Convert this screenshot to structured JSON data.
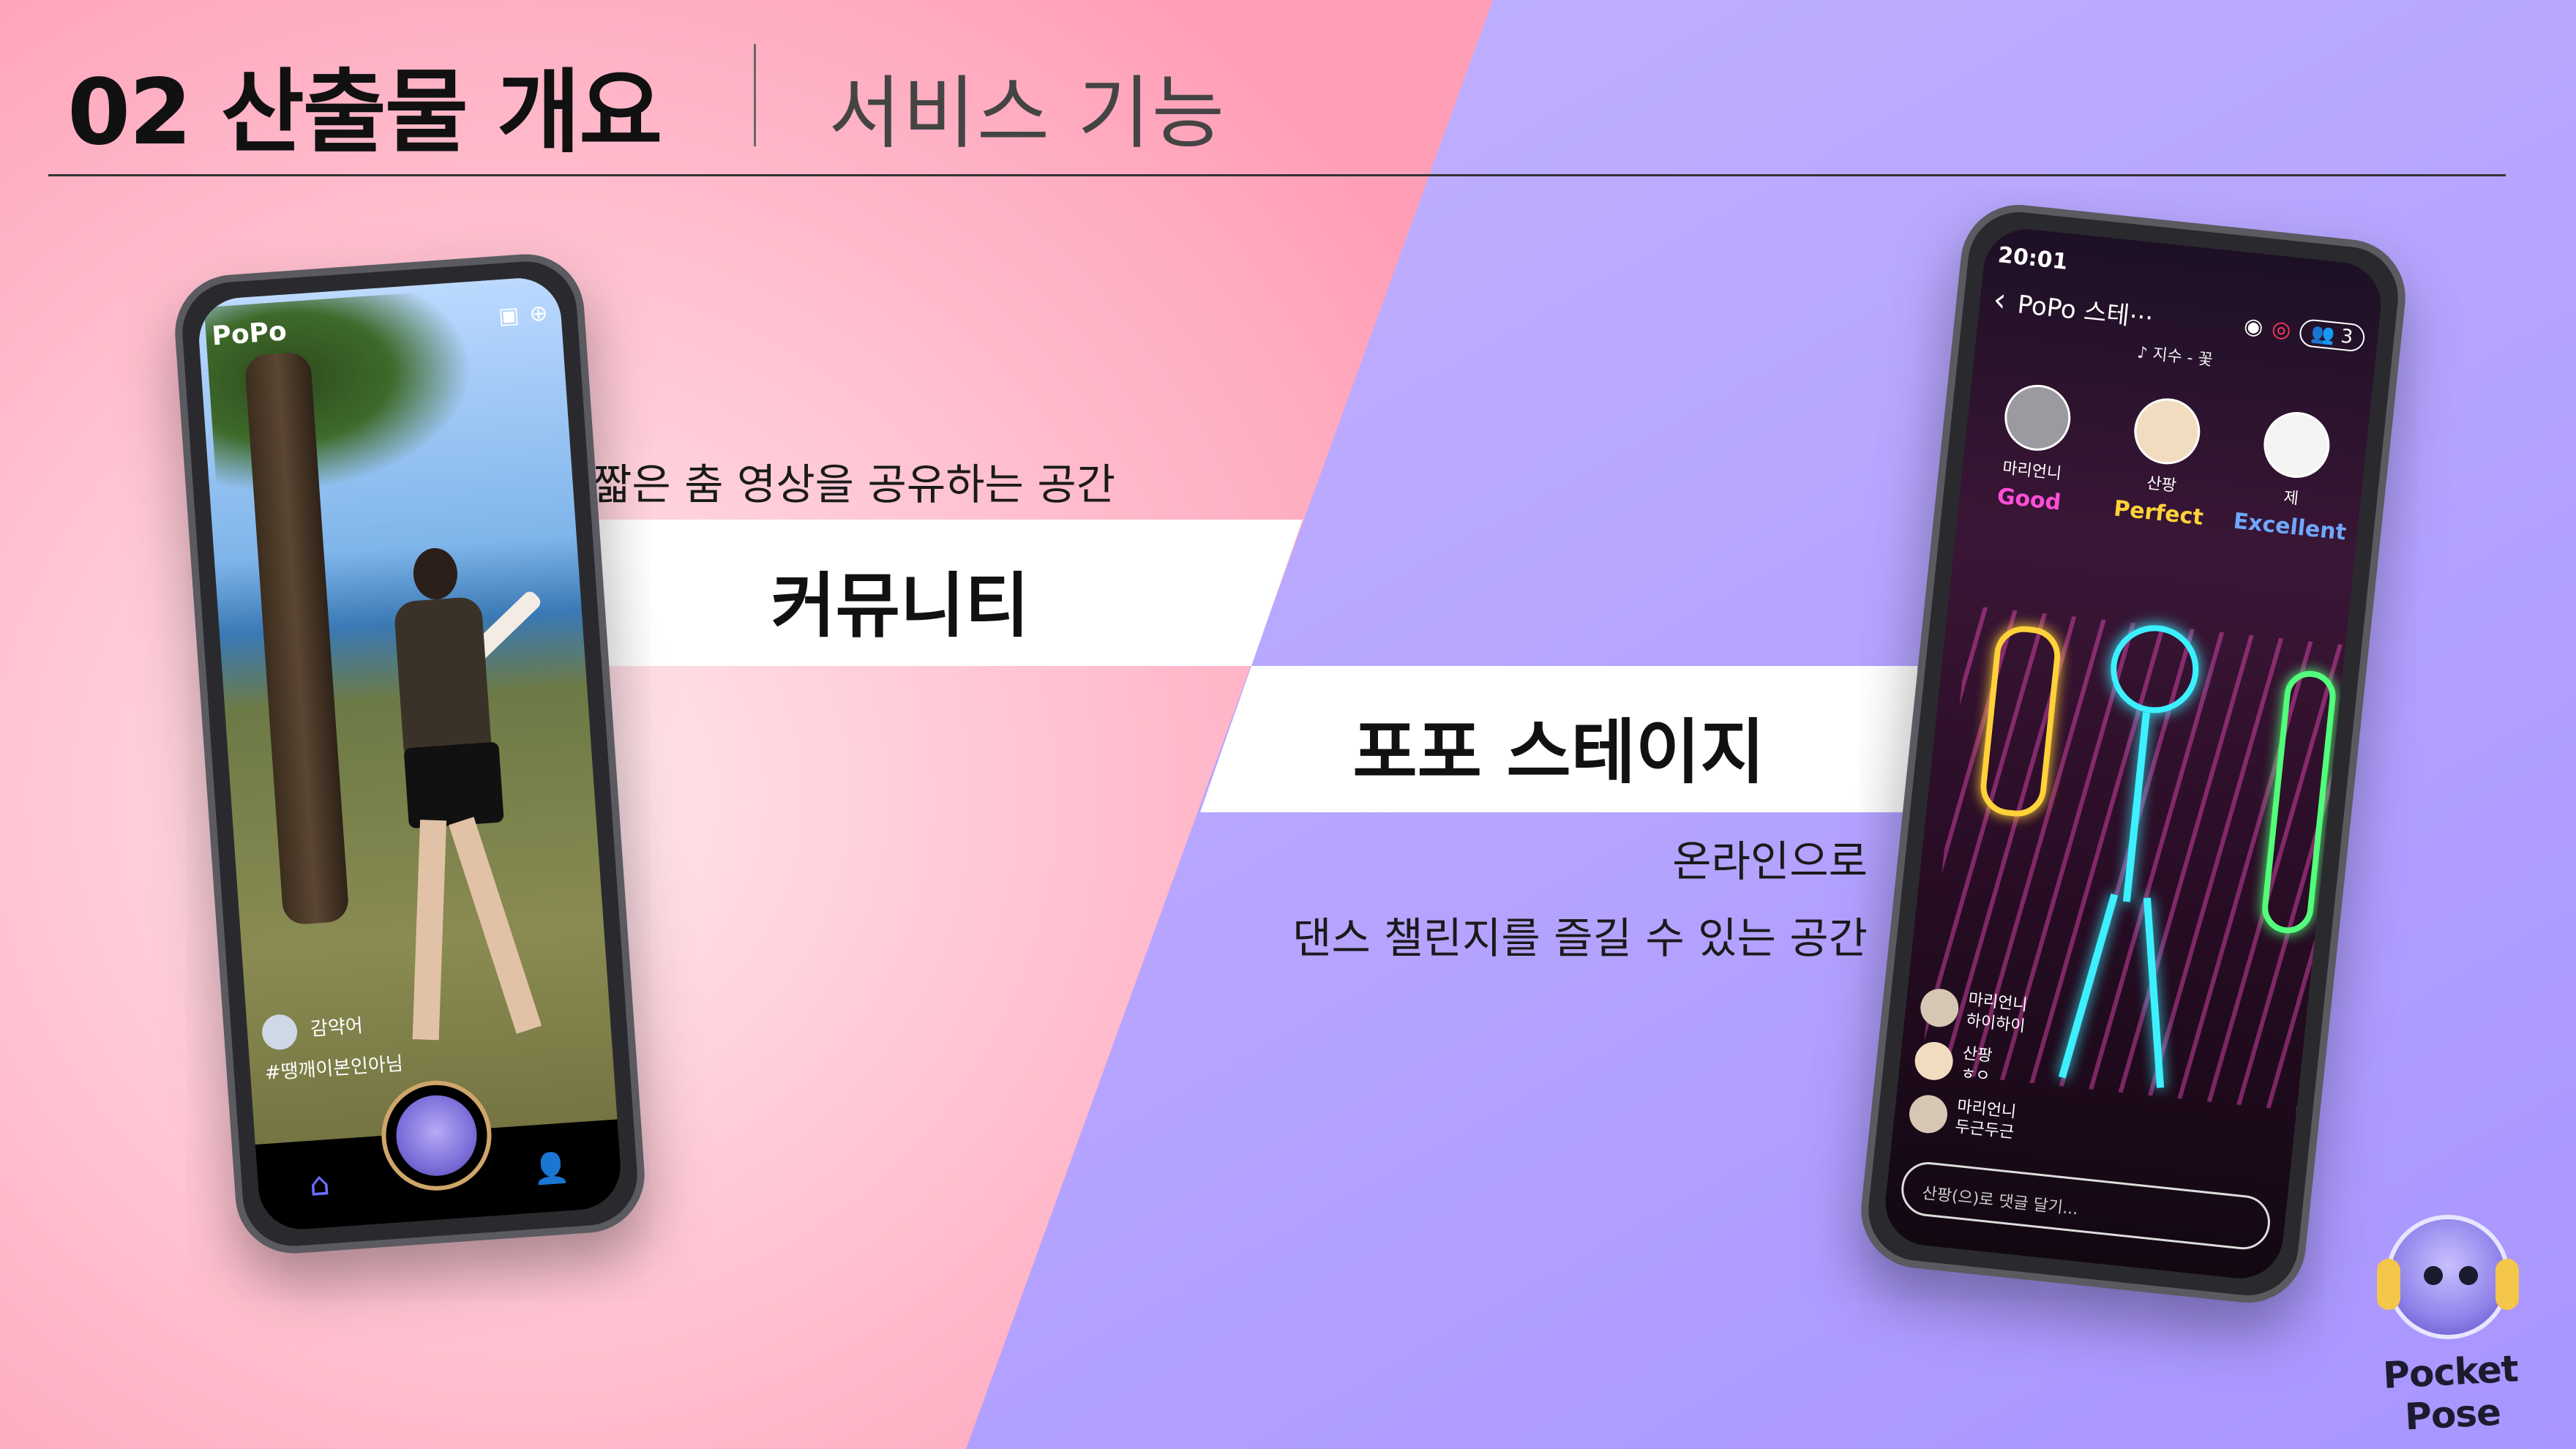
{
  "header": {
    "title": "02 산출물 개요",
    "subtitle": "서비스 기능"
  },
  "community": {
    "caption": "짧은 춤 영상을 공유하는 공간",
    "label": "커뮤니티"
  },
  "stage": {
    "label": "포포 스테이지",
    "caption_line1": "온라인으로",
    "caption_line2": "댄스 챌린지를 즐길 수 있는 공간"
  },
  "left_phone": {
    "brand": "PoPo",
    "user_name": "감약어",
    "hashtag": "#땡깨이본인아님",
    "icons": {
      "home": "home-icon",
      "profile": "person-icon",
      "center": "mascot-icon"
    }
  },
  "right_phone": {
    "time": "20:01",
    "room_title": "PoPo 스테···",
    "participant_count": "3",
    "song": "♪ 지수 - 꽃",
    "players": [
      {
        "name": "마리언니",
        "score": "Good",
        "color": "#ff4fd8"
      },
      {
        "name": "산팡",
        "score": "Perfect",
        "color": "#ffd23a"
      },
      {
        "name": "제",
        "score": "Excellent",
        "color": "#6fa8ff"
      }
    ],
    "chat": [
      {
        "name": "마리언니",
        "msg": "하이하이"
      },
      {
        "name": "산팡",
        "msg": "ㅎㅇ"
      },
      {
        "name": "마리언니",
        "msg": "두근두근"
      }
    ],
    "comment_placeholder": "산팡(으)로 댓글 달기..."
  },
  "logo": {
    "text": "Pocket Pose"
  },
  "colors": {
    "left_bg": "#ffb1c4",
    "right_bg": "#b9a6ff",
    "band": "#ffffff"
  }
}
